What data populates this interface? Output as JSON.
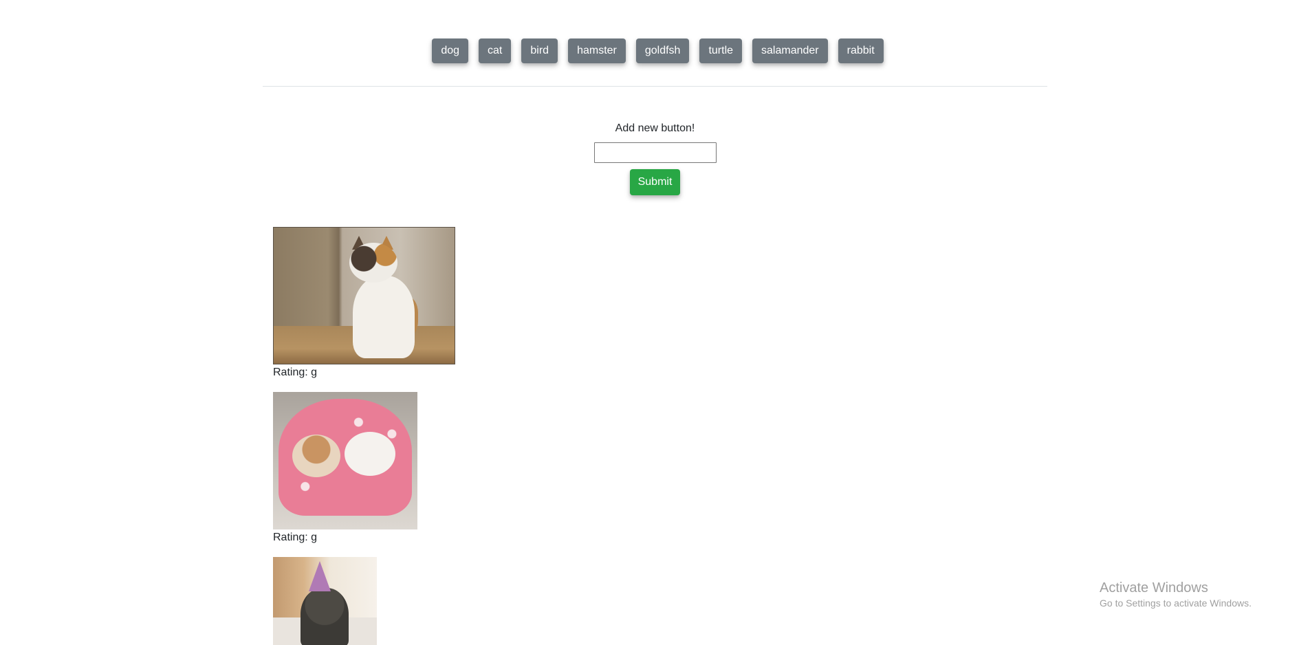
{
  "topic_buttons": [
    {
      "label": "dog"
    },
    {
      "label": "cat"
    },
    {
      "label": "bird"
    },
    {
      "label": "hamster"
    },
    {
      "label": "goldfsh"
    },
    {
      "label": "turtle"
    },
    {
      "label": "salamander"
    },
    {
      "label": "rabbit"
    }
  ],
  "add_form": {
    "label": "Add new button!",
    "input_value": "",
    "submit_label": "Submit"
  },
  "gifs": [
    {
      "rating": "Rating: g"
    },
    {
      "rating": "Rating: g"
    }
  ],
  "watermark": {
    "title": "Activate Windows",
    "subtitle": "Go to Settings to activate Windows."
  },
  "colors": {
    "topic_button": "#6c757d",
    "submit_button": "#28a745"
  }
}
